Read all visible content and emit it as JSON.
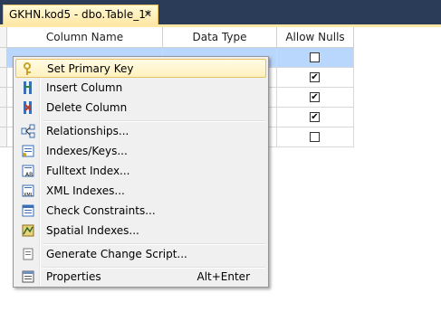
{
  "tab": {
    "title": "GKHN.kod5 - dbo.Table_1*",
    "close_glyph": "✕"
  },
  "grid": {
    "headers": [
      "Column Name",
      "Data Type",
      "Allow Nulls"
    ],
    "rows": [
      {
        "column_name": "",
        "data_type": "",
        "allow_nulls": false,
        "selected": true
      },
      {
        "column_name": "",
        "data_type": "",
        "allow_nulls": true
      },
      {
        "column_name": "",
        "data_type": "",
        "allow_nulls": true
      },
      {
        "column_name": "",
        "data_type": "",
        "allow_nulls": true
      },
      {
        "column_name": "",
        "data_type": "",
        "allow_nulls": false
      }
    ],
    "selection_color": "#b9d7fc"
  },
  "context_menu": {
    "items": [
      {
        "label": "Set Primary Key",
        "icon": "key-icon",
        "highlighted": true
      },
      {
        "label": "Insert Column",
        "icon": "insert-column-icon"
      },
      {
        "label": "Delete Column",
        "icon": "delete-column-icon"
      },
      {
        "label": "Relationships...",
        "icon": "relationships-icon"
      },
      {
        "label": "Indexes/Keys...",
        "icon": "indexes-keys-icon"
      },
      {
        "label": "Fulltext Index...",
        "icon": "fulltext-index-icon"
      },
      {
        "label": "XML Indexes...",
        "icon": "xml-indexes-icon"
      },
      {
        "label": "Check Constraints...",
        "icon": "check-constraints-icon"
      },
      {
        "label": "Spatial Indexes...",
        "icon": "spatial-indexes-icon"
      },
      {
        "label": "Generate Change Script...",
        "icon": "generate-script-icon"
      },
      {
        "label": "Properties",
        "icon": "properties-icon",
        "shortcut": "Alt+Enter"
      }
    ],
    "highlight_color": "#fff1bd"
  }
}
